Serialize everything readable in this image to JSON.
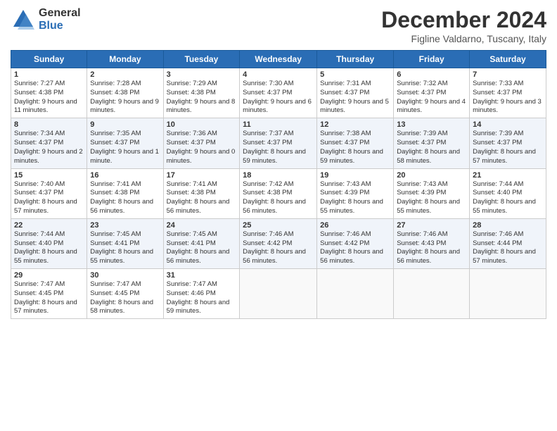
{
  "header": {
    "logo_general": "General",
    "logo_blue": "Blue",
    "month_title": "December 2024",
    "location": "Figline Valdarno, Tuscany, Italy"
  },
  "weekdays": [
    "Sunday",
    "Monday",
    "Tuesday",
    "Wednesday",
    "Thursday",
    "Friday",
    "Saturday"
  ],
  "weeks": [
    [
      {
        "day": "1",
        "sunrise": "Sunrise: 7:27 AM",
        "sunset": "Sunset: 4:38 PM",
        "daylight": "Daylight: 9 hours and 11 minutes."
      },
      {
        "day": "2",
        "sunrise": "Sunrise: 7:28 AM",
        "sunset": "Sunset: 4:38 PM",
        "daylight": "Daylight: 9 hours and 9 minutes."
      },
      {
        "day": "3",
        "sunrise": "Sunrise: 7:29 AM",
        "sunset": "Sunset: 4:38 PM",
        "daylight": "Daylight: 9 hours and 8 minutes."
      },
      {
        "day": "4",
        "sunrise": "Sunrise: 7:30 AM",
        "sunset": "Sunset: 4:37 PM",
        "daylight": "Daylight: 9 hours and 6 minutes."
      },
      {
        "day": "5",
        "sunrise": "Sunrise: 7:31 AM",
        "sunset": "Sunset: 4:37 PM",
        "daylight": "Daylight: 9 hours and 5 minutes."
      },
      {
        "day": "6",
        "sunrise": "Sunrise: 7:32 AM",
        "sunset": "Sunset: 4:37 PM",
        "daylight": "Daylight: 9 hours and 4 minutes."
      },
      {
        "day": "7",
        "sunrise": "Sunrise: 7:33 AM",
        "sunset": "Sunset: 4:37 PM",
        "daylight": "Daylight: 9 hours and 3 minutes."
      }
    ],
    [
      {
        "day": "8",
        "sunrise": "Sunrise: 7:34 AM",
        "sunset": "Sunset: 4:37 PM",
        "daylight": "Daylight: 9 hours and 2 minutes."
      },
      {
        "day": "9",
        "sunrise": "Sunrise: 7:35 AM",
        "sunset": "Sunset: 4:37 PM",
        "daylight": "Daylight: 9 hours and 1 minute."
      },
      {
        "day": "10",
        "sunrise": "Sunrise: 7:36 AM",
        "sunset": "Sunset: 4:37 PM",
        "daylight": "Daylight: 9 hours and 0 minutes."
      },
      {
        "day": "11",
        "sunrise": "Sunrise: 7:37 AM",
        "sunset": "Sunset: 4:37 PM",
        "daylight": "Daylight: 8 hours and 59 minutes."
      },
      {
        "day": "12",
        "sunrise": "Sunrise: 7:38 AM",
        "sunset": "Sunset: 4:37 PM",
        "daylight": "Daylight: 8 hours and 59 minutes."
      },
      {
        "day": "13",
        "sunrise": "Sunrise: 7:39 AM",
        "sunset": "Sunset: 4:37 PM",
        "daylight": "Daylight: 8 hours and 58 minutes."
      },
      {
        "day": "14",
        "sunrise": "Sunrise: 7:39 AM",
        "sunset": "Sunset: 4:37 PM",
        "daylight": "Daylight: 8 hours and 57 minutes."
      }
    ],
    [
      {
        "day": "15",
        "sunrise": "Sunrise: 7:40 AM",
        "sunset": "Sunset: 4:37 PM",
        "daylight": "Daylight: 8 hours and 57 minutes."
      },
      {
        "day": "16",
        "sunrise": "Sunrise: 7:41 AM",
        "sunset": "Sunset: 4:38 PM",
        "daylight": "Daylight: 8 hours and 56 minutes."
      },
      {
        "day": "17",
        "sunrise": "Sunrise: 7:41 AM",
        "sunset": "Sunset: 4:38 PM",
        "daylight": "Daylight: 8 hours and 56 minutes."
      },
      {
        "day": "18",
        "sunrise": "Sunrise: 7:42 AM",
        "sunset": "Sunset: 4:38 PM",
        "daylight": "Daylight: 8 hours and 56 minutes."
      },
      {
        "day": "19",
        "sunrise": "Sunrise: 7:43 AM",
        "sunset": "Sunset: 4:39 PM",
        "daylight": "Daylight: 8 hours and 55 minutes."
      },
      {
        "day": "20",
        "sunrise": "Sunrise: 7:43 AM",
        "sunset": "Sunset: 4:39 PM",
        "daylight": "Daylight: 8 hours and 55 minutes."
      },
      {
        "day": "21",
        "sunrise": "Sunrise: 7:44 AM",
        "sunset": "Sunset: 4:40 PM",
        "daylight": "Daylight: 8 hours and 55 minutes."
      }
    ],
    [
      {
        "day": "22",
        "sunrise": "Sunrise: 7:44 AM",
        "sunset": "Sunset: 4:40 PM",
        "daylight": "Daylight: 8 hours and 55 minutes."
      },
      {
        "day": "23",
        "sunrise": "Sunrise: 7:45 AM",
        "sunset": "Sunset: 4:41 PM",
        "daylight": "Daylight: 8 hours and 55 minutes."
      },
      {
        "day": "24",
        "sunrise": "Sunrise: 7:45 AM",
        "sunset": "Sunset: 4:41 PM",
        "daylight": "Daylight: 8 hours and 56 minutes."
      },
      {
        "day": "25",
        "sunrise": "Sunrise: 7:46 AM",
        "sunset": "Sunset: 4:42 PM",
        "daylight": "Daylight: 8 hours and 56 minutes."
      },
      {
        "day": "26",
        "sunrise": "Sunrise: 7:46 AM",
        "sunset": "Sunset: 4:42 PM",
        "daylight": "Daylight: 8 hours and 56 minutes."
      },
      {
        "day": "27",
        "sunrise": "Sunrise: 7:46 AM",
        "sunset": "Sunset: 4:43 PM",
        "daylight": "Daylight: 8 hours and 56 minutes."
      },
      {
        "day": "28",
        "sunrise": "Sunrise: 7:46 AM",
        "sunset": "Sunset: 4:44 PM",
        "daylight": "Daylight: 8 hours and 57 minutes."
      }
    ],
    [
      {
        "day": "29",
        "sunrise": "Sunrise: 7:47 AM",
        "sunset": "Sunset: 4:45 PM",
        "daylight": "Daylight: 8 hours and 57 minutes."
      },
      {
        "day": "30",
        "sunrise": "Sunrise: 7:47 AM",
        "sunset": "Sunset: 4:45 PM",
        "daylight": "Daylight: 8 hours and 58 minutes."
      },
      {
        "day": "31",
        "sunrise": "Sunrise: 7:47 AM",
        "sunset": "Sunset: 4:46 PM",
        "daylight": "Daylight: 8 hours and 59 minutes."
      },
      null,
      null,
      null,
      null
    ]
  ]
}
